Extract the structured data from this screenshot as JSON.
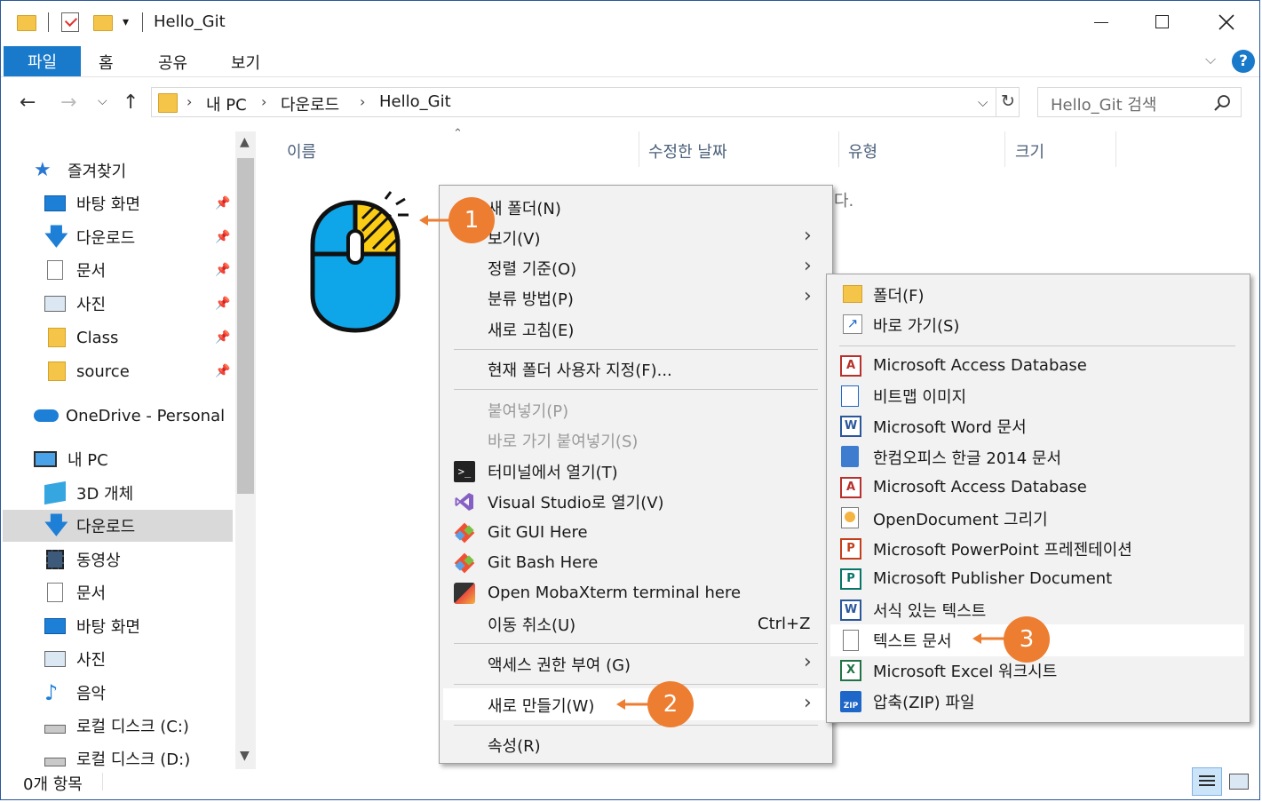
{
  "window": {
    "title": "Hello_Git",
    "controls": [
      "minimize",
      "maximize",
      "close"
    ]
  },
  "ribbon": {
    "tabs": [
      "파일",
      "홈",
      "공유",
      "보기"
    ],
    "help": "?"
  },
  "address_bar": {
    "path": [
      "내 PC",
      "다운로드",
      "Hello_Git"
    ],
    "search_placeholder": "Hello_Git 검색"
  },
  "nav_pane": {
    "quick_access": "즐겨찾기",
    "quick_items": [
      "바탕 화면",
      "다운로드",
      "문서",
      "사진",
      "Class",
      "source"
    ],
    "onedrive": "OneDrive - Personal",
    "this_pc": "내 PC",
    "pc_items": [
      "3D 개체",
      "다운로드",
      "동영상",
      "문서",
      "바탕 화면",
      "사진",
      "음악",
      "로컬 디스크 (C:)",
      "로컬 디스크 (D:)"
    ],
    "selected": "다운로드"
  },
  "file_list": {
    "columns": [
      "이름",
      "수정한 날짜",
      "유형",
      "크기"
    ],
    "empty_text_fragment": "다."
  },
  "context_menu": {
    "items": [
      {
        "label": "새 폴더(N)"
      },
      {
        "label": "보기(V)"
      },
      {
        "label": "정렬 기준(O)"
      },
      {
        "label": "분류 방법(P)"
      },
      {
        "label": "새로 고침(E)"
      },
      {
        "label": "현재 폴더 사용자 지정(F)..."
      },
      {
        "label": "붙여넣기(P)"
      },
      {
        "label": "바로 가기 붙여넣기(S)"
      },
      {
        "label": "터미널에서 열기(T)"
      },
      {
        "label": "Visual Studio로 열기(V)"
      },
      {
        "label": "Git GUI Here"
      },
      {
        "label": "Git Bash Here"
      },
      {
        "label": "Open MobaXterm terminal here"
      },
      {
        "label": "이동 취소(U)",
        "shortcut": "Ctrl+Z"
      },
      {
        "label": "액세스 권한 부여 (G)"
      },
      {
        "label": "새로 만들기(W)"
      },
      {
        "label": "속성(R)"
      }
    ]
  },
  "new_submenu": {
    "items": [
      "폴더(F)",
      "바로 가기(S)",
      "Microsoft Access Database",
      "비트맵 이미지",
      "Microsoft Word 문서",
      "한컴오피스 한글 2014 문서",
      "Microsoft Access Database",
      "OpenDocument 그리기",
      "Microsoft PowerPoint 프레젠테이션",
      "Microsoft Publisher Document",
      "서식 있는 텍스트",
      "텍스트 문서",
      "Microsoft Excel 워크시트",
      "압축(ZIP) 파일"
    ],
    "highlighted": "텍스트 문서"
  },
  "annotations": {
    "badges": [
      "1",
      "2",
      "3"
    ],
    "accent": "#ed7d31"
  },
  "status_bar": {
    "count": "0개 항목"
  },
  "colors": {
    "ribbon_file_tab": "#1979ca",
    "menu_bg": "#f2f2f2",
    "selection": "#d9d9d9"
  }
}
